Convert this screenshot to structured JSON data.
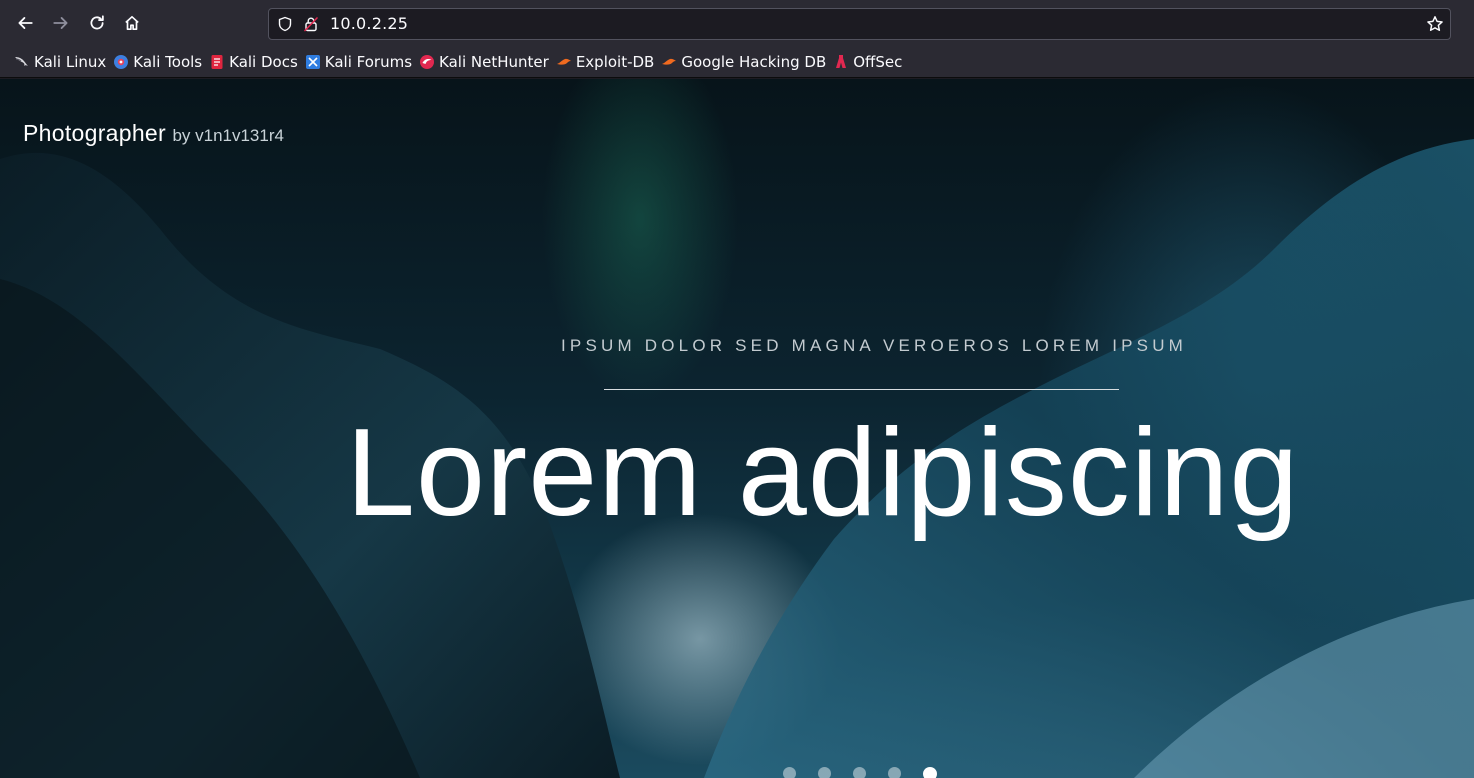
{
  "browser": {
    "url": "10.0.2.25",
    "bookmarks": [
      {
        "label": "Kali Linux",
        "icon": "kali-dragon-icon"
      },
      {
        "label": "Kali Tools",
        "icon": "kali-tools-icon"
      },
      {
        "label": "Kali Docs",
        "icon": "kali-docs-icon"
      },
      {
        "label": "Kali Forums",
        "icon": "kali-forums-icon"
      },
      {
        "label": "Kali NetHunter",
        "icon": "kali-nethunter-icon"
      },
      {
        "label": "Exploit-DB",
        "icon": "exploit-db-icon"
      },
      {
        "label": "Google Hacking DB",
        "icon": "ghdb-icon"
      },
      {
        "label": "OffSec",
        "icon": "offsec-icon"
      }
    ]
  },
  "site": {
    "brand_name": "Photographer",
    "brand_by": "by v1n1v131r4",
    "kicker": "IPSUM DOLOR SED MAGNA VEROEROS LOREM IPSUM",
    "headline": "Lorem adipiscing",
    "slides_total": 5,
    "active_slide": 5
  },
  "colors": {
    "chrome": "#2b2a33",
    "urlbar": "#1c1b22",
    "accent_red": "#e22850"
  }
}
